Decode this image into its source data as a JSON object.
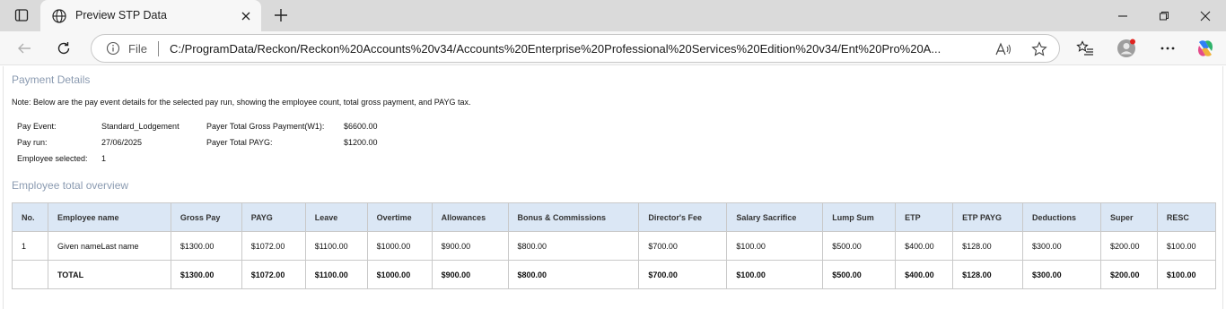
{
  "browser": {
    "tab_title": "Preview STP Data",
    "address_scheme_label": "File",
    "address_url": "C:/ProgramData/Reckon/Reckon%20Accounts%20v34/Accounts%20Enterprise%20Professional%20Services%20Edition%20v34/Ent%20Pro%20A...",
    "icons": [
      "tab-actions-icon",
      "globe-icon",
      "close-icon",
      "plus-icon",
      "minimize-icon",
      "restore-icon",
      "window-close-icon",
      "back-arrow-icon",
      "refresh-icon",
      "info-icon",
      "read-aloud-icon",
      "favorite-star-icon",
      "favorites-list-icon",
      "profile-avatar-icon",
      "more-icon",
      "copilot-icon"
    ]
  },
  "payment_details": {
    "title": "Payment Details",
    "note": "Note: Below are the pay event details for the selected pay run, showing the employee count, total gross payment, and PAYG tax.",
    "pay_event_label": "Pay Event:",
    "pay_event_value": "Standard_Lodgement",
    "pay_run_label": "Pay run:",
    "pay_run_value": "27/06/2025",
    "employee_selected_label": "Employee selected:",
    "employee_selected_value": "1",
    "gross_label": "Payer Total Gross Payment(W1):",
    "gross_value": "$6600.00",
    "payg_label": "Payer Total PAYG:",
    "payg_value": "$1200.00"
  },
  "overview": {
    "title": "Employee total overview",
    "columns": [
      "No.",
      "Employee name",
      "Gross Pay",
      "PAYG",
      "Leave",
      "Overtime",
      "Allowances",
      "Bonus & Commissions",
      "Director's Fee",
      "Salary Sacrifice",
      "Lump Sum",
      "ETP",
      "ETP PAYG",
      "Deductions",
      "Super",
      "RESC"
    ],
    "rows": [
      [
        "1",
        "Given nameLast name",
        "$1300.00",
        "$1072.00",
        "$1100.00",
        "$1000.00",
        "$900.00",
        "$800.00",
        "$700.00",
        "$100.00",
        "$500.00",
        "$400.00",
        "$128.00",
        "$300.00",
        "$200.00",
        "$100.00"
      ]
    ],
    "total": [
      "",
      "TOTAL",
      "$1300.00",
      "$1072.00",
      "$1100.00",
      "$1000.00",
      "$900.00",
      "$800.00",
      "$700.00",
      "$100.00",
      "$500.00",
      "$400.00",
      "$128.00",
      "$300.00",
      "$200.00",
      "$100.00"
    ]
  }
}
